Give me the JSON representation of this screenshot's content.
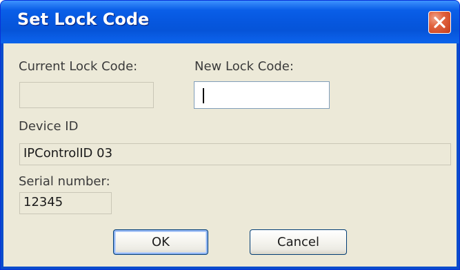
{
  "dialog": {
    "title": "Set Lock Code",
    "close_icon": "close-icon"
  },
  "form": {
    "current_lock_code_label": "Current Lock Code:",
    "current_lock_code_value": "",
    "new_lock_code_label": "New Lock Code:",
    "new_lock_code_value": "",
    "device_id_label": "Device ID",
    "device_id_value": "IPControlID 03",
    "serial_number_label": "Serial number:",
    "serial_number_value": "12345"
  },
  "buttons": {
    "ok_label": "OK",
    "cancel_label": "Cancel"
  },
  "colors": {
    "titlebar": "#0758e0",
    "client_background": "#ece9d8",
    "close_button": "#e1623d"
  }
}
